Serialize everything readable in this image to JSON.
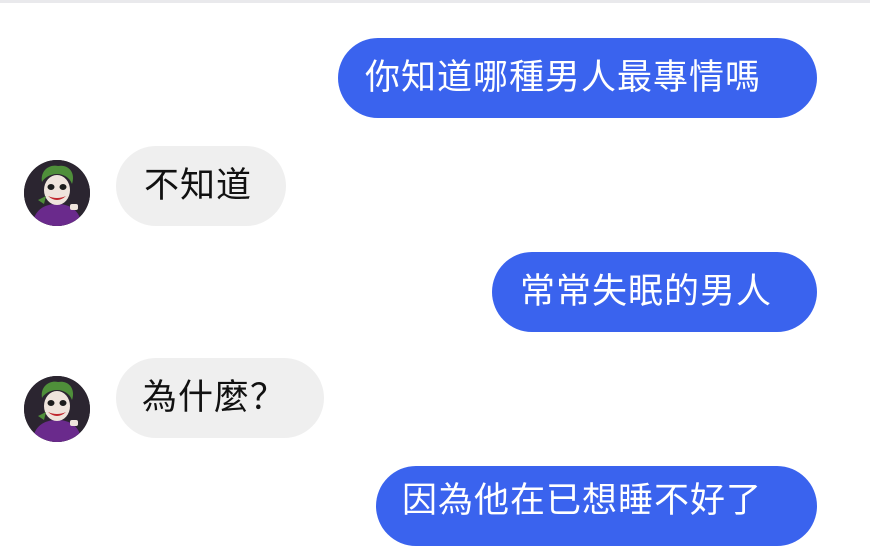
{
  "messages": [
    {
      "text": "你知道哪種男人最專情嗎",
      "sender": "me"
    },
    {
      "text": "不知道",
      "sender": "contact"
    },
    {
      "text": "常常失眠的男人",
      "sender": "me"
    },
    {
      "text": "為什麼？",
      "sender": "contact"
    },
    {
      "text": "因為他在已想睡不好了",
      "sender": "me"
    }
  ],
  "avatar": {
    "icon": "joker-avatar-icon"
  },
  "colors": {
    "outgoing_bubble": "#3a63ee",
    "incoming_bubble": "#efefef",
    "background": "#ffffff"
  }
}
